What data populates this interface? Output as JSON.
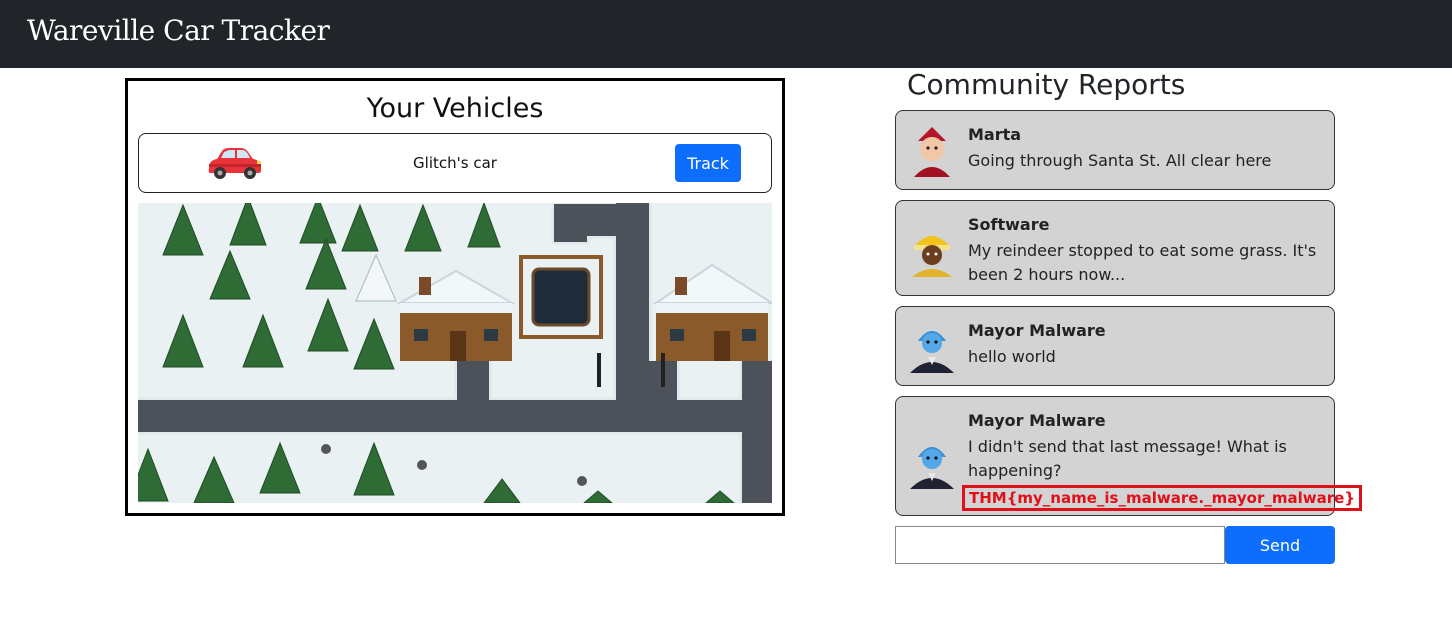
{
  "navbar": {
    "brand": "Wareville Car Tracker"
  },
  "vehicles": {
    "title": "Your Vehicles",
    "items": [
      {
        "name": "Glitch's car",
        "icon": "car-icon",
        "action_label": "Track"
      }
    ]
  },
  "reports": {
    "title": "Community Reports",
    "items": [
      {
        "author": "Marta",
        "message": "Going through Santa St. All clear here",
        "avatar": "elf-avatar"
      },
      {
        "author": "Software",
        "message": "My reindeer stopped to eat some grass. It's been 2 hours now...",
        "avatar": "yellow-hat-avatar"
      },
      {
        "author": "Mayor Malware",
        "message": "hello world",
        "avatar": "mayor-malware-avatar"
      },
      {
        "author": "Mayor Malware",
        "message": "I didn't send that last message! What is happening?",
        "flag": "THM{my_name_is_malware._mayor_malware}",
        "avatar": "mayor-malware-avatar"
      }
    ],
    "input_value": "",
    "send_label": "Send"
  },
  "colors": {
    "navbar_bg": "#212529",
    "accent": "#0d6efd",
    "card_bg": "#d3d3d3",
    "flag": "#e0101a"
  }
}
